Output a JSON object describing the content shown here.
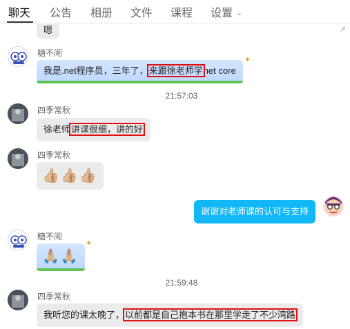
{
  "tabs": [
    {
      "label": "聊天"
    },
    {
      "label": "公告"
    },
    {
      "label": "相册"
    },
    {
      "label": "文件"
    },
    {
      "label": "课程"
    },
    {
      "label": "设置"
    }
  ],
  "messages": {
    "m0": {
      "text": "嗯"
    },
    "m1": {
      "sender": "糖不闹",
      "text_a": "我是.net程序员，三年了，",
      "highlight": "来跟徐老师学",
      "text_b": "net core"
    },
    "t1": "21:57:03",
    "m2": {
      "sender": "四季常秋",
      "text_a": "徐老师",
      "highlight": "讲课很细，讲的好"
    },
    "m3": {
      "sender": "四季常秋",
      "emoji": "👍🏼👍🏼👍🏼"
    },
    "m4": {
      "text": "谢谢对老师课的认可与支持"
    },
    "m5": {
      "sender": "糖不闹",
      "emoji": "🙏🏼🙏🏼"
    },
    "t2": "21:59:48",
    "m6": {
      "sender": "四季常秋",
      "text_a": "我听您的课太晚了，",
      "highlight": "以前都是自己抱本书在那里学走了不少湾路"
    }
  },
  "icons": {
    "settings_chevron": "chevron-down-icon"
  },
  "colors": {
    "highlight_border": "#e01010",
    "self_bubble": "#12b7f5",
    "other_bubble": "#ebebeb"
  }
}
